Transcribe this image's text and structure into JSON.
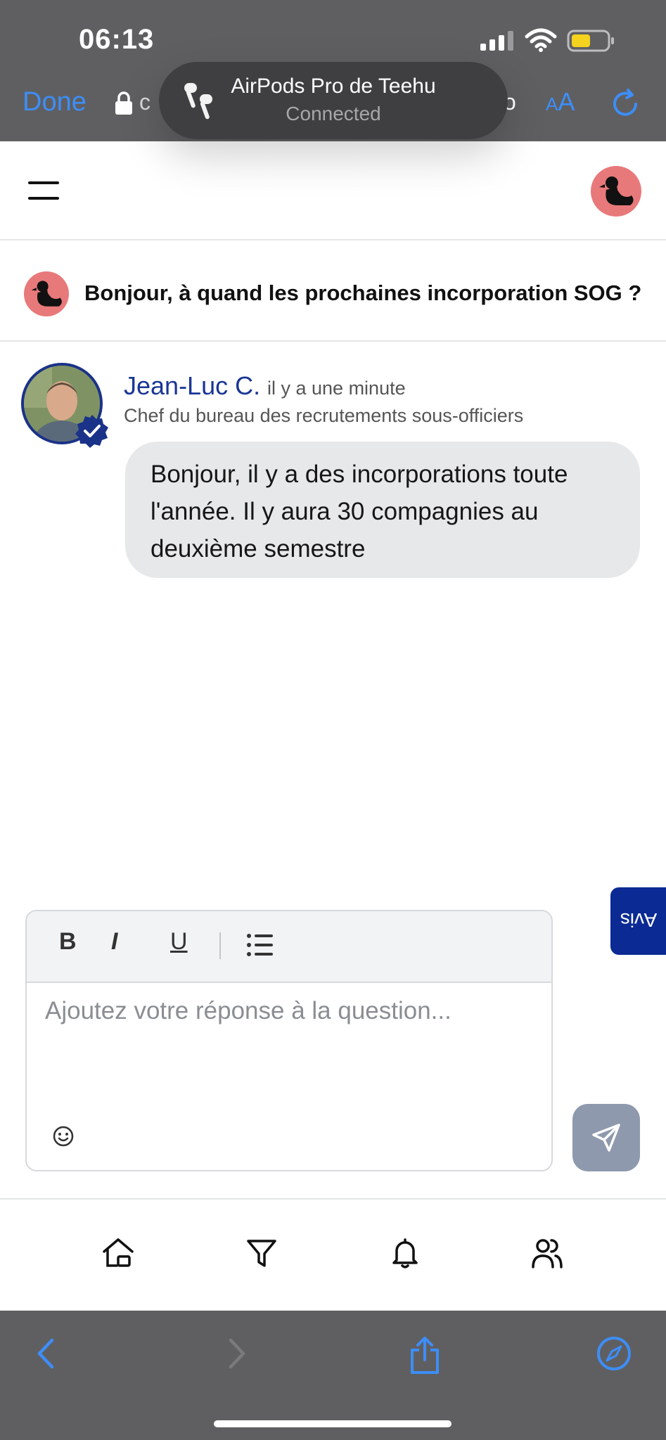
{
  "status_bar": {
    "time": "06:13"
  },
  "browser": {
    "done_label": "Done",
    "url_left": "c",
    "url_right": "o",
    "text_size_small": "A",
    "text_size_big": "A",
    "accent": "#3d8ef7"
  },
  "airpods": {
    "name": "AirPods Pro de Teehu",
    "status": "Connected"
  },
  "question": {
    "text": "Bonjour, à quand les prochaines incorporation SOG ?"
  },
  "answer": {
    "author": "Jean-Luc C.",
    "time": "il y a une minute",
    "role": "Chef du bureau des recrutements sous-officiers",
    "text": "Bonjour, il y a des incorporations toute l'année. Il y aura 30 compagnies au deuxième semestre"
  },
  "avis_tab": {
    "label": "Avis",
    "color": "#0b2a94"
  },
  "editor": {
    "bold": "B",
    "italic": "I",
    "underline": "U",
    "placeholder": "Ajoutez votre réponse à la question..."
  },
  "bottom_nav": {
    "items": [
      {
        "icon": "home-icon"
      },
      {
        "icon": "filter-icon"
      },
      {
        "icon": "bell-icon"
      },
      {
        "icon": "users-icon"
      }
    ]
  },
  "colors": {
    "avatar_bg": "#e8797a",
    "name_blue": "#1a3695",
    "send_bg": "#8e99ad"
  }
}
